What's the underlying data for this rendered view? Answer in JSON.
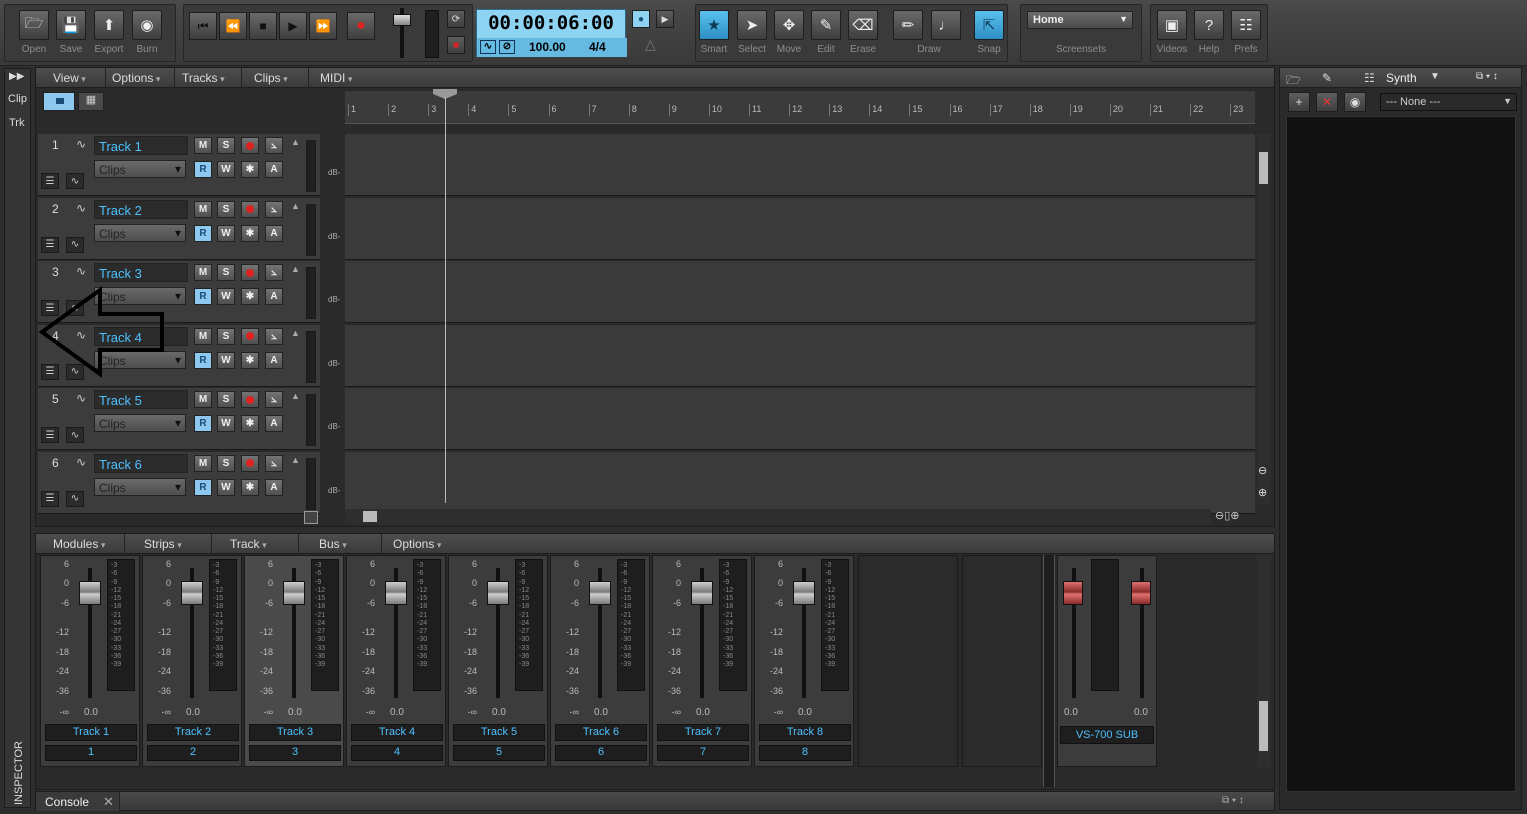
{
  "toolbar": {
    "file": [
      {
        "label": "Open",
        "icon": "folder-icon"
      },
      {
        "label": "Save",
        "icon": "save-icon"
      },
      {
        "label": "Export",
        "icon": "export-icon"
      },
      {
        "label": "Burn",
        "icon": "burn-icon"
      }
    ],
    "time": "00:00:06:00",
    "tempo": "100.00",
    "meter": "4/4",
    "tools": [
      {
        "label": "Smart"
      },
      {
        "label": "Select"
      },
      {
        "label": "Move"
      },
      {
        "label": "Edit"
      },
      {
        "label": "Erase"
      }
    ],
    "draw_label": "Draw",
    "snap_label": "Snap",
    "screenset": "Home",
    "screensets_label": "Screensets",
    "help": [
      {
        "label": "Videos"
      },
      {
        "label": "Help"
      },
      {
        "label": "Prefs"
      }
    ]
  },
  "left_tabs": [
    "Clip",
    "Trk"
  ],
  "inspector_label": "INSPECTOR",
  "track_menu": [
    "View",
    "Options",
    "Tracks",
    "Clips",
    "MIDI"
  ],
  "ruler": [
    "1",
    "2",
    "3",
    "4",
    "5",
    "6",
    "7",
    "8",
    "9",
    "10",
    "11",
    "12",
    "13",
    "14",
    "15",
    "16",
    "17",
    "18",
    "19",
    "20",
    "21",
    "22",
    "23"
  ],
  "tracks": [
    {
      "num": "1",
      "name": "Track 1",
      "clips": "Clips"
    },
    {
      "num": "2",
      "name": "Track 2",
      "clips": "Clips"
    },
    {
      "num": "3",
      "name": "Track 3",
      "clips": "Clips"
    },
    {
      "num": "4",
      "name": "Track 4",
      "clips": "Clips"
    },
    {
      "num": "5",
      "name": "Track 5",
      "clips": "Clips"
    },
    {
      "num": "6",
      "name": "Track 6",
      "clips": "Clips"
    }
  ],
  "track_buttons": {
    "mute": "M",
    "solo": "S",
    "read": "R",
    "write": "W",
    "auto": "A",
    "db": "dB-"
  },
  "console_menu": [
    "Modules",
    "Strips",
    "Track",
    "Bus",
    "Options"
  ],
  "fader_scale": [
    "6",
    "0",
    "-6",
    "-12",
    "-18",
    "-24",
    "-36",
    "-∞"
  ],
  "meter_scale": [
    "-3",
    "-6",
    "-9",
    "-12",
    "-15",
    "-18",
    "-21",
    "-24",
    "-27",
    "-30",
    "-33",
    "-36",
    "-39"
  ],
  "strips": [
    {
      "name": "Track 1",
      "num": "1",
      "val": "0.0"
    },
    {
      "name": "Track 2",
      "num": "2",
      "val": "0.0"
    },
    {
      "name": "Track 3",
      "num": "3",
      "val": "0.0"
    },
    {
      "name": "Track 4",
      "num": "4",
      "val": "0.0"
    },
    {
      "name": "Track 5",
      "num": "5",
      "val": "0.0"
    },
    {
      "name": "Track 6",
      "num": "6",
      "val": "0.0"
    },
    {
      "name": "Track 7",
      "num": "7",
      "val": "0.0"
    },
    {
      "name": "Track 8",
      "num": "8",
      "val": "0.0"
    }
  ],
  "bus": {
    "name": "VS-700 SUB",
    "val_l": "0.0",
    "val_r": "0.0"
  },
  "console_tab": "Console",
  "synth": {
    "tab": "Synth",
    "preset": "--- None ---"
  },
  "colors": {
    "accent": "#4ec1ff",
    "clock": "#8fd3f3",
    "rec": "#dd2222",
    "bus_fader": "#c84040"
  }
}
